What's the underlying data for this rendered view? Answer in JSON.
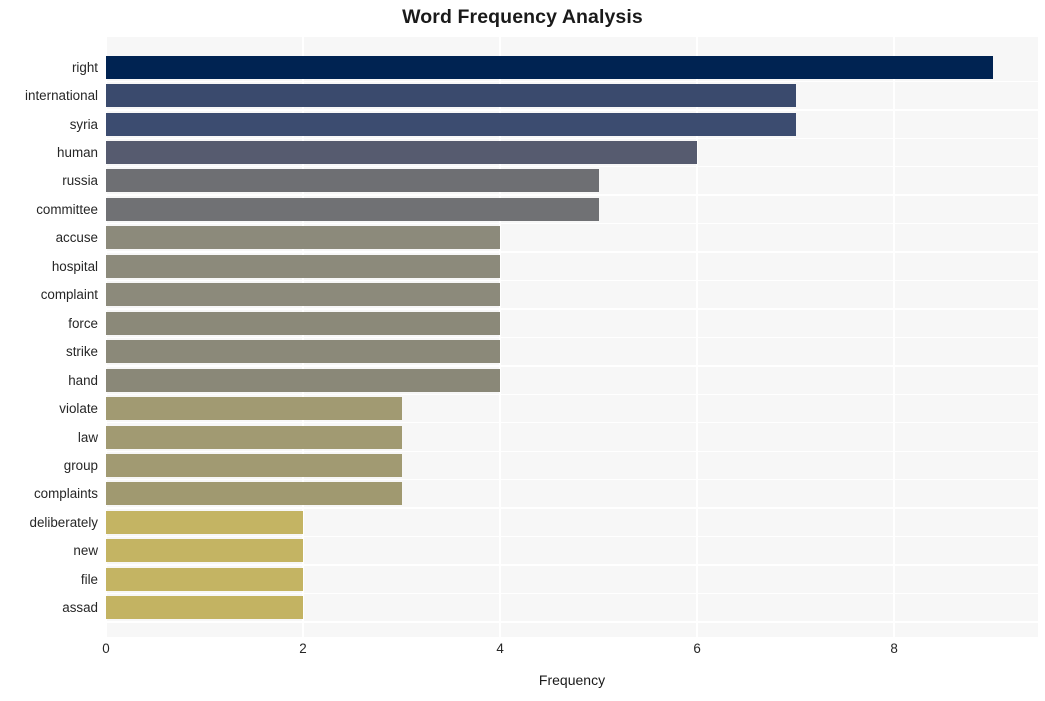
{
  "chart_data": {
    "type": "bar",
    "orientation": "horizontal",
    "title": "Word Frequency Analysis",
    "xlabel": "Frequency",
    "ylabel": "",
    "categories": [
      "right",
      "international",
      "syria",
      "human",
      "russia",
      "committee",
      "accuse",
      "hospital",
      "complaint",
      "force",
      "strike",
      "hand",
      "violate",
      "law",
      "group",
      "complaints",
      "deliberately",
      "new",
      "file",
      "assad"
    ],
    "values": [
      9,
      7,
      7,
      6,
      5,
      5,
      4,
      4,
      4,
      4,
      4,
      4,
      3,
      3,
      3,
      3,
      2,
      2,
      2,
      2
    ],
    "bar_colors": [
      "#002352",
      "#3a4a6d",
      "#3c4c70",
      "#565b6f",
      "#6e6f73",
      "#707174",
      "#8c8a7b",
      "#8c8a7b",
      "#8c8a7b",
      "#8b8979",
      "#8b8979",
      "#8a8878",
      "#a19a72",
      "#a19a72",
      "#a19a72",
      "#a09970",
      "#c4b463",
      "#c4b463",
      "#c4b463",
      "#c3b362"
    ],
    "xlim": [
      0,
      9.46
    ],
    "ylim_categories": 20,
    "xticks": [
      0,
      2,
      4,
      6,
      8
    ],
    "xticklabels": [
      "0",
      "2",
      "4",
      "6",
      "8"
    ],
    "grid": true,
    "grid_color": "#ffffff",
    "plot_background": "#f7f7f7",
    "figure_background": "#ffffff",
    "legend": null,
    "axis_text_color": "#262626",
    "title_color": "#1a1a1a"
  }
}
